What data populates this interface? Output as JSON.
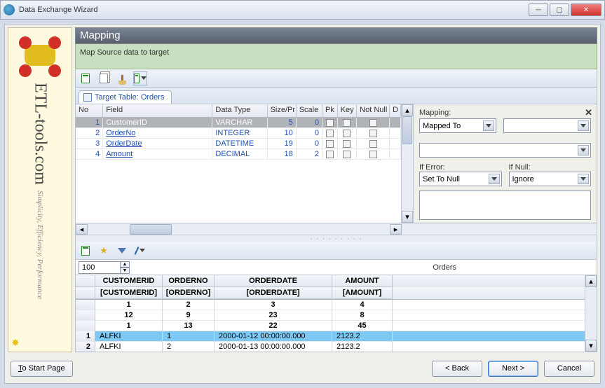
{
  "window": {
    "title": "Data Exchange Wizard"
  },
  "banner": {
    "brand": "ETL-tools.com",
    "tagline": "Simplicity, Efficiency, Performance"
  },
  "header": {
    "title": "Mapping",
    "subtitle": "Map Source data to target"
  },
  "tab": {
    "label": "Target Table: Orders"
  },
  "targetGrid": {
    "columns": {
      "no": "No",
      "field": "Field",
      "dataType": "Data Type",
      "sizePr": "Size/Pr",
      "scale": "Scale",
      "pk": "Pk",
      "key": "Key",
      "notNull": "Not Null",
      "d": "D"
    },
    "rows": [
      {
        "no": "1",
        "field": "CustomerID",
        "dataType": "VARCHAR",
        "size": "5",
        "scale": "0",
        "sel": true
      },
      {
        "no": "2",
        "field": "OrderNo",
        "dataType": "INTEGER",
        "size": "10",
        "scale": "0"
      },
      {
        "no": "3",
        "field": "OrderDate",
        "dataType": "DATETIME",
        "size": "19",
        "scale": "0"
      },
      {
        "no": "4",
        "field": "Amount",
        "dataType": "DECIMAL",
        "size": "18",
        "scale": "2"
      }
    ]
  },
  "mappingPanel": {
    "mappingLabel": "Mapping:",
    "mappedTo": "Mapped To",
    "ifErrorLabel": "If Error:",
    "ifErrorValue": "Set To Null",
    "ifNullLabel": "If Null:",
    "ifNullValue": "Ignore"
  },
  "lower": {
    "count": "100",
    "tableName": "Orders",
    "headers": {
      "cust": "CUSTOMERID",
      "ordn": "ORDERNO",
      "date": "ORDERDATE",
      "amt": "AMOUNT"
    },
    "bindings": {
      "cust": "[CUSTOMERID]",
      "ordn": "[ORDERNO]",
      "date": "[ORDERDATE]",
      "amt": "[AMOUNT]"
    },
    "summary": [
      {
        "cust": "1",
        "ordn": "2",
        "date": "3",
        "amt": "4"
      },
      {
        "cust": "12",
        "ordn": "9",
        "date": "23",
        "amt": "8"
      },
      {
        "cust": "1",
        "ordn": "13",
        "date": "22",
        "amt": "45"
      }
    ],
    "rows": [
      {
        "idx": "1",
        "cust": "ALFKI",
        "ordn": "1",
        "date": "2000-01-12 00:00:00.000",
        "amt": "2123.2",
        "sel": true
      },
      {
        "idx": "2",
        "cust": "ALFKI",
        "ordn": "2",
        "date": "2000-01-13 00:00:00.000",
        "amt": "2123.2"
      }
    ]
  },
  "buttons": {
    "start": "To Start Page",
    "back": "< Back",
    "next": "Next >",
    "cancel": "Cancel"
  }
}
